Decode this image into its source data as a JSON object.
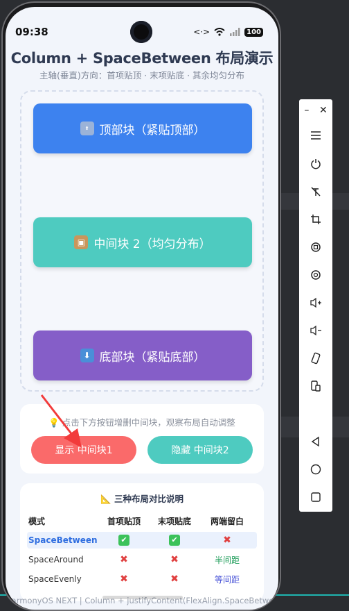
{
  "status": {
    "time": "09:38",
    "battery": "100"
  },
  "header": {
    "title": "Column + SpaceBetween 布局演示",
    "subtitle": "主轴(垂直)方向：首项贴顶 · 末项贴底 · 其余均匀分布"
  },
  "blocks": {
    "top": {
      "label": "顶部块（紧贴顶部）",
      "icon": "TOP"
    },
    "middle": {
      "label": "中间块 2（均匀分布）",
      "icon": "📦"
    },
    "bottom": {
      "label": "底部块（紧贴底部）",
      "icon": "⬇"
    }
  },
  "controls": {
    "hint": "💡 点击下方按钮增删中间块，观察布局自动调整",
    "show_button": "显示 中间块1",
    "hide_button": "隐藏 中间块2"
  },
  "comparison": {
    "title": "📐 三种布局对比说明",
    "headers": [
      "模式",
      "首项贴顶",
      "末项贴底",
      "两端留白"
    ],
    "rows": [
      {
        "mode": "SpaceBetween",
        "first": "✔",
        "last": "✔",
        "margin": "✖"
      },
      {
        "mode": "SpaceAround",
        "first": "✖",
        "last": "✖",
        "margin": "半间距"
      },
      {
        "mode": "SpaceEvenly",
        "first": "✖",
        "last": "✖",
        "margin": "等间距"
      }
    ]
  },
  "footer": "HarmonyOS NEXT | Column + justifyContent(FlexAlign.SpaceBetween)",
  "colors": {
    "top_block": "#3d82ef",
    "middle_block": "#4ecbc0",
    "bottom_block": "#855ec8",
    "show_button": "#fa6a6a",
    "hide_button": "#4ecbc0"
  }
}
